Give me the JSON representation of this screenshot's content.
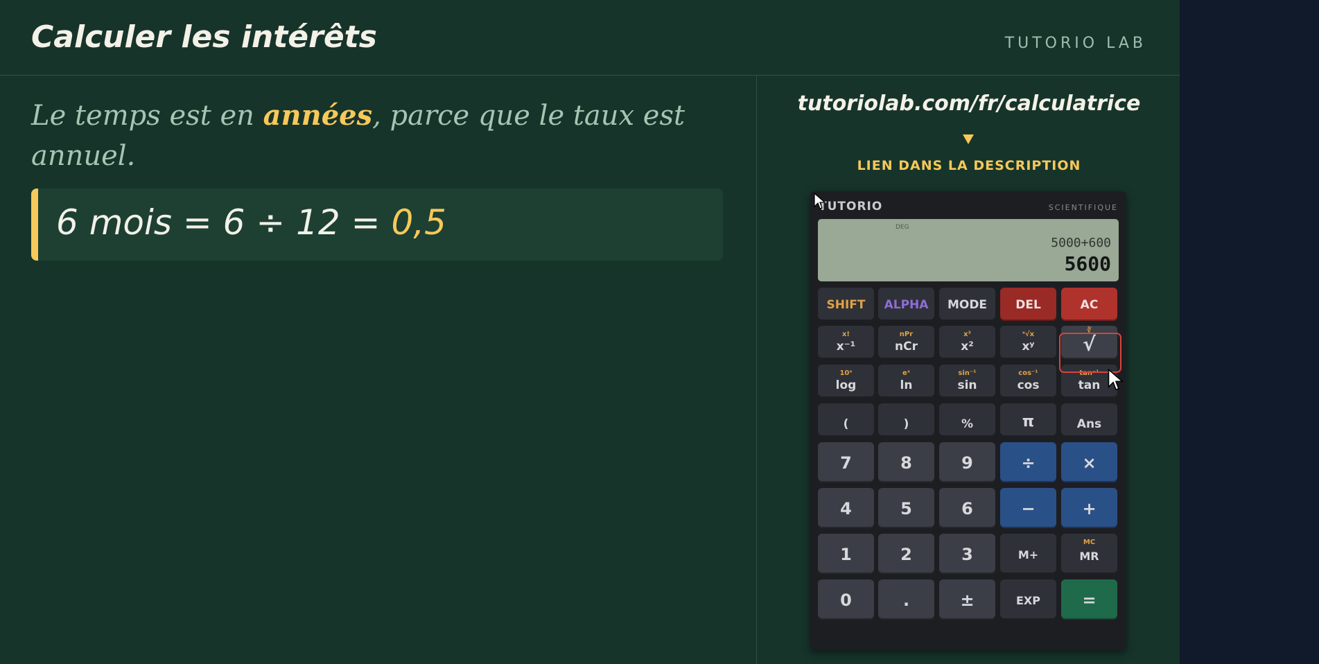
{
  "header": {
    "title": "Calculer les intérêts",
    "brand": "TUTORIO LAB"
  },
  "lesson": {
    "explain_before": "Le temps est en ",
    "explain_highlight": "années",
    "explain_after": ", parce que le taux est annuel.",
    "formula_text": "6 mois = 6 ÷ 12 = ",
    "formula_answer": "0,5"
  },
  "promo": {
    "url": "tutoriolab.com/fr/calculatrice",
    "link_label": "LIEN DANS LA DESCRIPTION"
  },
  "calculator": {
    "brand": "TUTORIO",
    "model": "SCIENTIFIQUE",
    "angle_mode": "DEG",
    "expression": "5000+600",
    "result": "5600",
    "keys": {
      "shift": "SHIFT",
      "alpha": "ALPHA",
      "mode": "MODE",
      "del": "DEL",
      "ac": "AC",
      "inv": "x⁻¹",
      "inv_sub": "x!",
      "ncr": "nCr",
      "ncr_sub": "nPr",
      "sq": "x²",
      "sq_sub": "x³",
      "pow": "xʸ",
      "pow_sub": "ˣ√x",
      "sqrt": "√",
      "sqrt_sub": "∛",
      "log": "log",
      "log_sub": "10ˣ",
      "ln": "ln",
      "ln_sub": "eˣ",
      "sin": "sin",
      "sin_sub": "sin⁻¹",
      "cos": "cos",
      "cos_sub": "cos⁻¹",
      "tan": "tan",
      "tan_sub": "tan⁻¹",
      "lparen": "(",
      "rparen": ")",
      "percent": "%",
      "pi": "π",
      "ans": "Ans",
      "n7": "7",
      "n8": "8",
      "n9": "9",
      "div": "÷",
      "mul": "×",
      "n4": "4",
      "n5": "5",
      "n6": "6",
      "minus": "−",
      "plus": "+",
      "n1": "1",
      "n2": "2",
      "n3": "3",
      "mplus": "M+",
      "mr": "MR",
      "mr_sub": "MC",
      "n0": "0",
      "dot": ".",
      "neg": "±",
      "exp": "EXP",
      "eq": "="
    }
  },
  "colors": {
    "board": "#17342a",
    "accent": "#f6c95a",
    "highlight_border": "#d8433b"
  }
}
